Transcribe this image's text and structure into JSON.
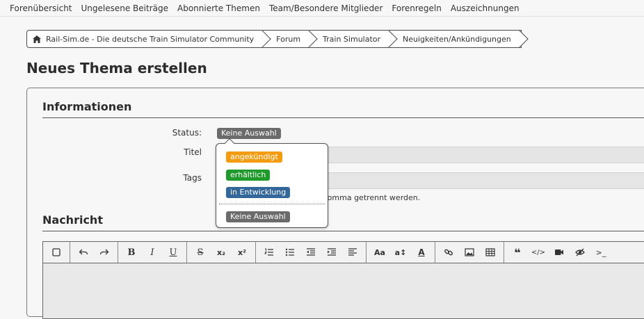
{
  "topnav": {
    "items": [
      "Forenübersicht",
      "Ungelesene Beiträge",
      "Abonnierte Themen",
      "Team/Besondere Mitglieder",
      "Forenregeln",
      "Auszeichnungen"
    ]
  },
  "breadcrumb": {
    "items": [
      "Rail-Sim.de - Die deutsche Train Simulator Community",
      "Forum",
      "Train Simulator",
      "Neuigkeiten/Ankündigungen"
    ]
  },
  "page": {
    "title": "Neues Thema erstellen"
  },
  "informationen": {
    "title": "Informationen",
    "status_label": "Status:",
    "status_value": "Keine Auswahl",
    "titel_label": "Titel",
    "tags_label": "Tags",
    "tags_hint": "Komma getrennt werden."
  },
  "nachricht": {
    "title": "Nachricht"
  },
  "status_dropdown": {
    "options": [
      {
        "label": "angekündigt",
        "color": "#f39c12"
      },
      {
        "label": "erhältlich",
        "color": "#1f9a2a"
      },
      {
        "label": "in Entwicklung",
        "color": "#336699"
      }
    ],
    "reset": {
      "label": "Keine Auswahl",
      "color": "#6b6b6b"
    }
  },
  "toolbar": {
    "groups": [
      [
        "checkbox-icon"
      ],
      [
        "undo-icon",
        "redo-icon"
      ],
      [
        "bold-icon",
        "italic-icon",
        "underline-icon"
      ],
      [
        "strikethrough-icon",
        "subscript-icon",
        "superscript-icon"
      ],
      [
        "ordered-list-icon",
        "unordered-list-icon",
        "outdent-icon",
        "indent-icon",
        "align-icon"
      ],
      [
        "font-size-icon",
        "text-size-icon",
        "font-color-icon"
      ],
      [
        "link-icon",
        "image-icon",
        "table-icon"
      ],
      [
        "quote-icon",
        "code-icon",
        "video-icon",
        "spoiler-icon",
        "terminal-icon"
      ]
    ],
    "glyphs": {
      "bold": "B",
      "italic": "I",
      "underline": "U",
      "strikethrough": "S",
      "subscript": "x₂",
      "superscript": "x²",
      "font_size": "Aa",
      "text_size": "a↕",
      "font_color": "A",
      "quote": "❝",
      "code": "</>",
      "terminal": ">_"
    }
  }
}
